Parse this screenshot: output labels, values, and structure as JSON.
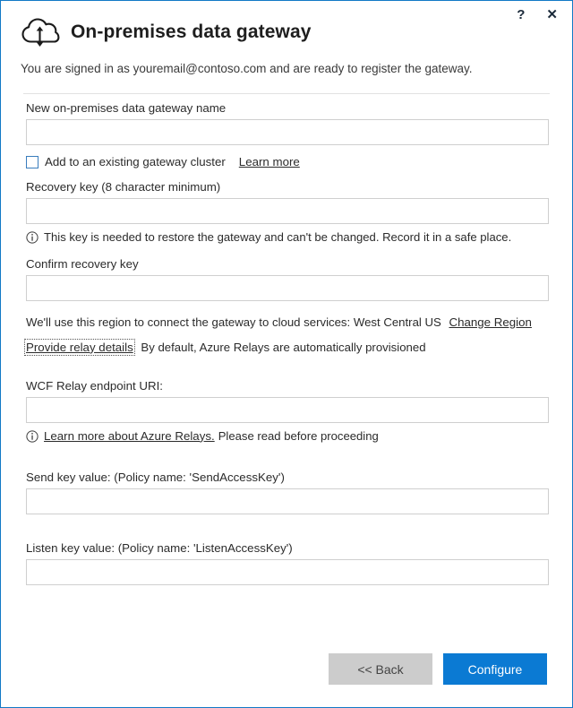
{
  "window": {
    "title": "On-premises data gateway",
    "icon": "cloud-updown-arrow-icon",
    "accent_color": "#1279c6",
    "help_label": "?",
    "close_label": "✕"
  },
  "header": {
    "signed_in_text": "You are signed in as youremail@contoso.com and are ready to register the gateway.",
    "account_email": "youremail@contoso.com"
  },
  "form": {
    "gateway_name": {
      "label": "New on-premises data gateway name",
      "value": "",
      "placeholder": ""
    },
    "cluster": {
      "checkbox_label": "Add to an existing gateway cluster",
      "checked": false,
      "learn_more_label": "Learn more"
    },
    "recovery_key": {
      "label": "Recovery key (8 character minimum)",
      "value": "",
      "placeholder": "",
      "hint": "This key is needed to restore the gateway and can't be changed. Record it in a safe place.",
      "hint_icon": "info-circle-icon"
    },
    "confirm_recovery_key": {
      "label": "Confirm recovery key",
      "value": "",
      "placeholder": ""
    },
    "region": {
      "text": "We'll use this region to connect the gateway to cloud services: West Central US",
      "region_name": "West Central US",
      "change_link_label": "Change Region"
    },
    "relay": {
      "toggle_link_label": "Provide relay details",
      "toggle_link_focused": true,
      "description": "By default, Azure Relays are automatically provisioned"
    },
    "wcf_relay_uri": {
      "label": "WCF Relay endpoint URI:",
      "value": "",
      "placeholder": "",
      "hint_icon": "info-circle-icon",
      "hint_link_label": "Learn more about Azure Relays.",
      "hint_text": "Please read before proceeding"
    },
    "send_key": {
      "label": "Send key value: (Policy name: 'SendAccessKey')",
      "value": "",
      "placeholder": ""
    },
    "listen_key": {
      "label": "Listen key value: (Policy name: 'ListenAccessKey')",
      "value": "",
      "placeholder": ""
    }
  },
  "footer": {
    "back_label": "<< Back",
    "configure_label": "Configure",
    "primary_color": "#0b7ad3"
  }
}
